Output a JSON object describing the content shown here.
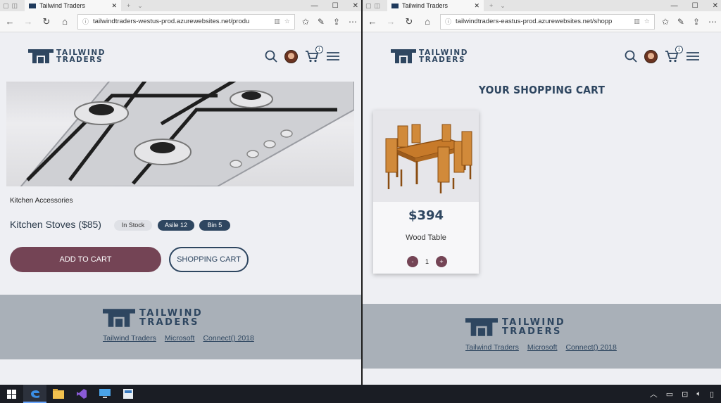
{
  "left_window": {
    "tab_title": "Tailwind Traders",
    "url": "tailwindtraders-westus-prod.azurewebsites.net/produ",
    "cart_count": "1",
    "brand_line1": "TAILWIND",
    "brand_line2": "TRADERS",
    "category": "Kitchen Accessories",
    "product_title": "Kitchen Stoves ($85)",
    "tags": {
      "stock": "In Stock",
      "aisle": "Asile 12",
      "bin": "Bin 5"
    },
    "add_to_cart_label": "ADD TO CART",
    "shopping_cart_label": "SHOPPING CART",
    "footer": {
      "brand_line1": "TAILWIND",
      "brand_line2": "TRADERS",
      "links": [
        "Tailwind Traders",
        "Microsoft",
        "Connect() 2018"
      ]
    }
  },
  "right_window": {
    "tab_title": "Tailwind Traders",
    "url": "tailwindtraders-eastus-prod.azurewebsites.net/shopp",
    "cart_count": "1",
    "brand_line1": "TAILWIND",
    "brand_line2": "TRADERS",
    "page_title": "YOUR SHOPPING CART",
    "cart_item": {
      "price": "$394",
      "name": "Wood Table",
      "quantity": "1",
      "minus": "-",
      "plus": "+"
    },
    "footer": {
      "brand_line1": "TAILWIND",
      "brand_line2": "TRADERS",
      "links": [
        "Tailwind Traders",
        "Microsoft",
        "Connect() 2018"
      ]
    }
  },
  "colors": {
    "brand_navy": "#2e4660",
    "accent_plum": "#744455",
    "footer_gray": "#a9b0b8",
    "page_bg": "#eeeff3"
  },
  "taskbar": {
    "apps": [
      "start-icon",
      "edge-icon",
      "file-explorer-icon",
      "visual-studio-icon",
      "remote-desktop-icon",
      "app-icon"
    ]
  }
}
